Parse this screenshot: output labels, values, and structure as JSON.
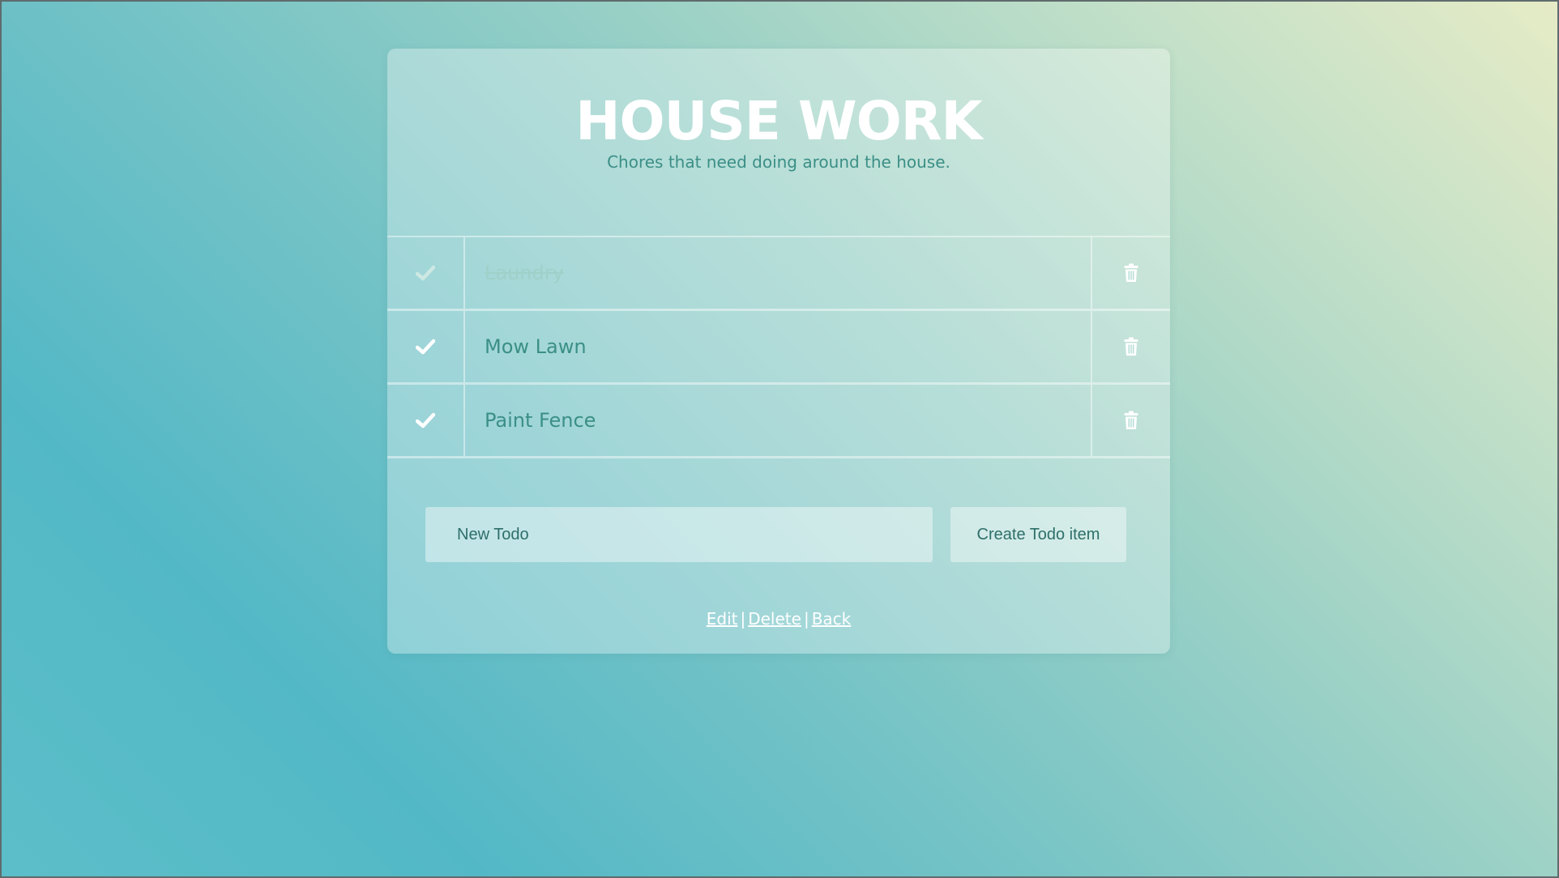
{
  "header": {
    "title": "HOUSE WORK",
    "subtitle": "Chores that need doing around the house."
  },
  "todos": [
    {
      "label": "Laundry",
      "done": true
    },
    {
      "label": "Mow Lawn",
      "done": false
    },
    {
      "label": "Paint Fence",
      "done": false
    }
  ],
  "form": {
    "input_value": "New Todo",
    "create_label": "Create Todo item"
  },
  "links": {
    "edit": "Edit",
    "delete": "Delete",
    "back": "Back",
    "separator": "|"
  },
  "colors": {
    "text_accent": "#3b8f86",
    "done_text": "#9fd1c9",
    "check_done": "#cde8e3",
    "check_pending": "#ffffff"
  },
  "icons": {
    "check": "check-icon",
    "delete": "trash-icon"
  }
}
